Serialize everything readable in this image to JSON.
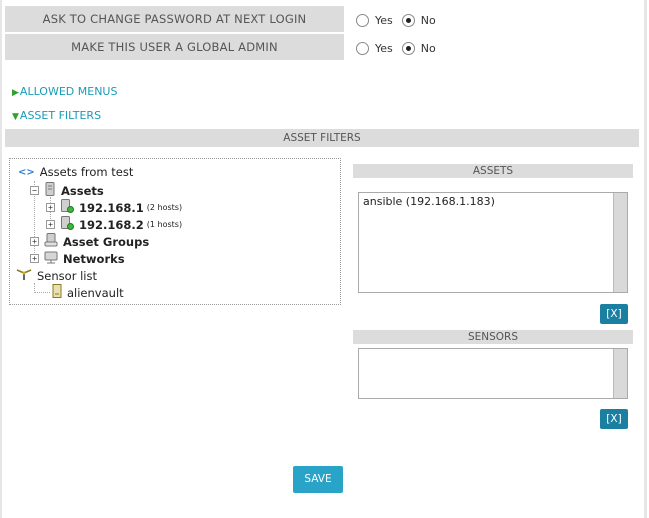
{
  "user_options": [
    {
      "label": "ASK TO CHANGE PASSWORD AT NEXT LOGIN",
      "yes": "Yes",
      "no": "No",
      "selected": "No"
    },
    {
      "label": "MAKE THIS USER A GLOBAL ADMIN",
      "yes": "Yes",
      "no": "No",
      "selected": "No"
    }
  ],
  "sections": {
    "allowed_menus": "ALLOWED MENUS",
    "asset_filters": "ASSET FILTERS"
  },
  "asset_filters_header": "ASSET FILTERS",
  "tree": {
    "root": "Assets from test",
    "assets": "Assets",
    "hosts": [
      {
        "name": "192.168.1",
        "count": "(2 hosts)"
      },
      {
        "name": "192.168.2",
        "count": "(1 hosts)"
      }
    ],
    "asset_groups": "Asset Groups",
    "networks": "Networks",
    "sensor_list": "Sensor list",
    "sensor": "alienvault"
  },
  "assets_panel": {
    "title": "ASSETS",
    "items": [
      "ansible (192.168.1.183)"
    ],
    "remove_label": "[X]"
  },
  "sensors_panel": {
    "title": "SENSORS",
    "items": [],
    "remove_label": "[X]"
  },
  "save_label": "SAVE",
  "colors": {
    "accent": "#1a9bb5",
    "button": "#2aa3c9",
    "remove_button": "#1a7fa0",
    "bar": "#dcdcdc"
  }
}
